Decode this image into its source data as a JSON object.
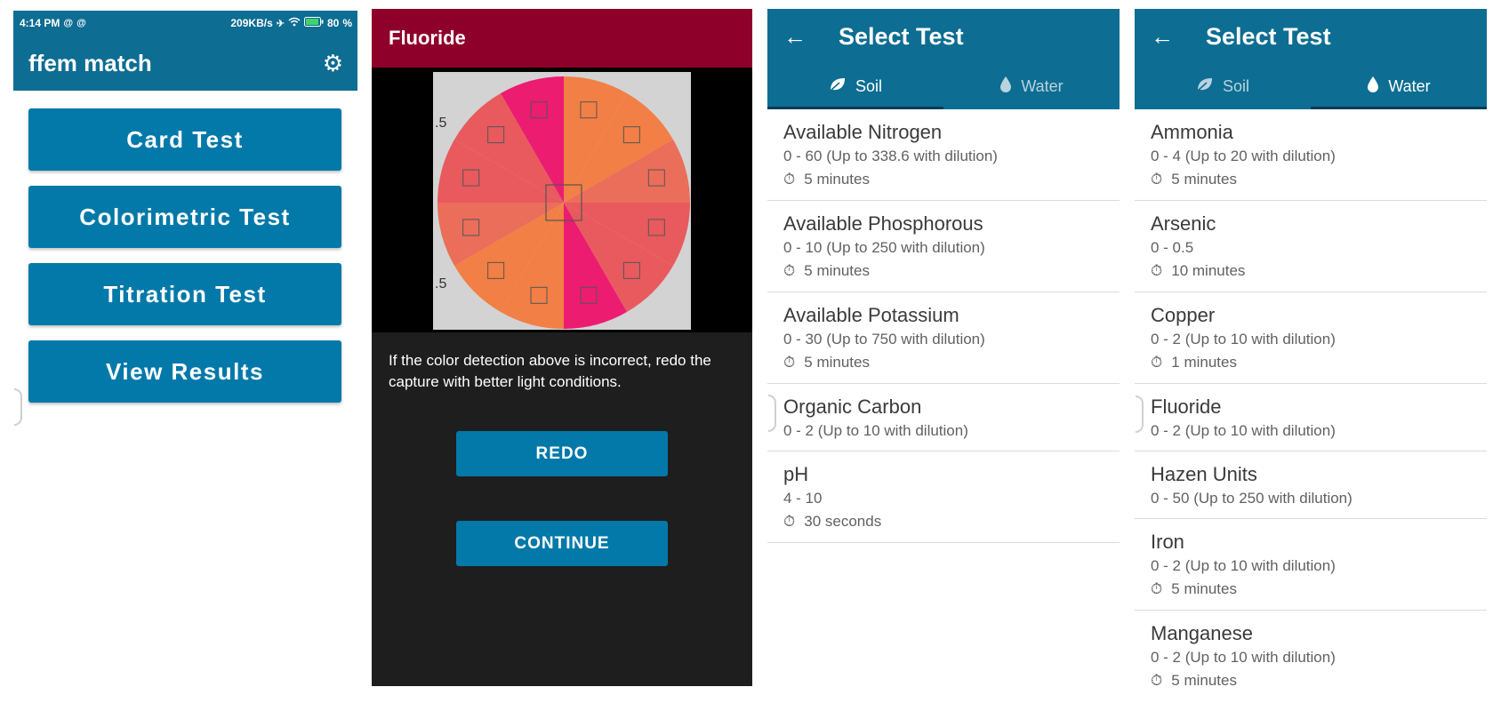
{
  "menu": {
    "status": {
      "time": "4:14 PM",
      "icons_left": [
        "@",
        "@"
      ],
      "speed": "209KB/s",
      "battery": "80",
      "network_icons": [
        "airplane-icon",
        "wifi-icon",
        "battery-icon"
      ]
    },
    "title": "ffem match",
    "buttons": [
      "Card Test",
      "Colorimetric Test",
      "Titration Test",
      "View Results"
    ]
  },
  "result": {
    "title": "Fluoride",
    "partial_labels": [
      ".5",
      ".5"
    ],
    "wheel_colors": {
      "pink": "#ec1c71",
      "orange": "#f27f45",
      "coral": "#e85a5d",
      "salmon": "#eb6e5a",
      "background": "#d3d3d3"
    },
    "message": "If the color detection above is incorrect, redo the capture with better light conditions.",
    "redo_label": "REDO",
    "continue_label": "CONTINUE"
  },
  "soil": {
    "title": "Select Test",
    "tabs": [
      {
        "label": "Soil",
        "icon": "leaf-icon",
        "active": true
      },
      {
        "label": "Water",
        "icon": "drop-icon",
        "active": false
      }
    ],
    "items": [
      {
        "name": "Available Nitrogen",
        "range": "0 - 60 (Up to 338.6 with dilution)",
        "time": "5 minutes"
      },
      {
        "name": "Available Phosphorous",
        "range": "0 - 10 (Up to 250 with dilution)",
        "time": "5 minutes"
      },
      {
        "name": "Available Potassium",
        "range": "0 - 30 (Up to 750 with dilution)",
        "time": "5 minutes"
      },
      {
        "name": "Organic Carbon",
        "range": "0 - 2 (Up to 10 with dilution)",
        "time": ""
      },
      {
        "name": "pH",
        "range": "4 - 10",
        "time": "30 seconds"
      }
    ]
  },
  "water": {
    "title": "Select Test",
    "tabs": [
      {
        "label": "Soil",
        "icon": "leaf-icon",
        "active": false
      },
      {
        "label": "Water",
        "icon": "drop-icon",
        "active": true
      }
    ],
    "items": [
      {
        "name": "Ammonia",
        "range": "0 - 4 (Up to 20 with dilution)",
        "time": "5 minutes"
      },
      {
        "name": "Arsenic",
        "range": "0 - 0.5",
        "time": "10 minutes"
      },
      {
        "name": "Copper",
        "range": "0 - 2 (Up to 10 with dilution)",
        "time": "1 minutes"
      },
      {
        "name": "Fluoride",
        "range": "0 - 2 (Up to 10 with dilution)",
        "time": ""
      },
      {
        "name": "Hazen Units",
        "range": "0 - 50 (Up to 250 with dilution)",
        "time": ""
      },
      {
        "name": "Iron",
        "range": "0 - 2 (Up to 10 with dilution)",
        "time": "5 minutes"
      },
      {
        "name": "Manganese",
        "range": "0 - 2 (Up to 10 with dilution)",
        "time": "5 minutes"
      }
    ]
  },
  "colors": {
    "primary_dark": "#0d6d92",
    "button_blue": "#0379a9",
    "fluoride_red": "#8e0029",
    "dark_bg": "#1e1e1e"
  }
}
